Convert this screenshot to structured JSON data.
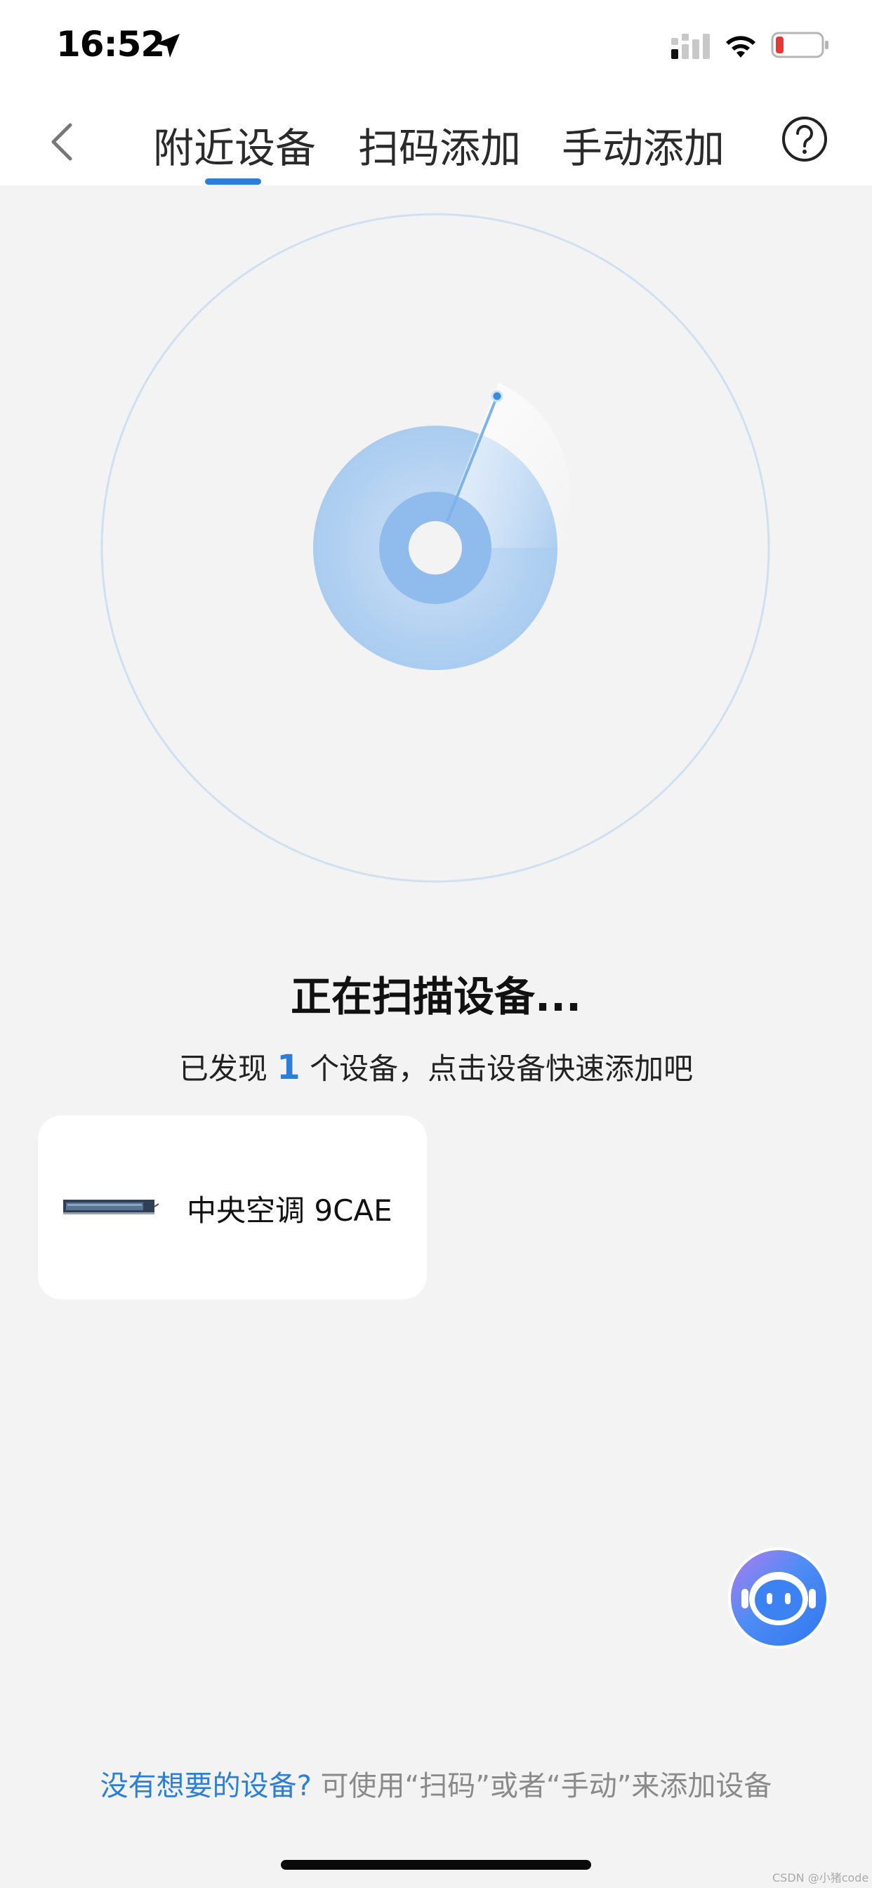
{
  "status_bar": {
    "time": "16:52",
    "battery_color": "#e53935"
  },
  "nav": {
    "tabs": [
      {
        "label": "附近设备",
        "active": true
      },
      {
        "label": "扫码添加",
        "active": false
      },
      {
        "label": "手动添加",
        "active": false
      }
    ],
    "accent_color": "#2b7fd9"
  },
  "scan": {
    "title": "正在扫描设备...",
    "found_prefix": "已发现",
    "found_count": "1",
    "found_suffix": "个设备，点击设备快速添加吧"
  },
  "devices": [
    {
      "name": "中央空调 9CAE",
      "icon": "central-ac-unit-icon"
    }
  ],
  "footer": {
    "link_text": "没有想要的设备?",
    "rest_text": "可使用“扫码”或者“手动”来添加设备"
  },
  "watermark": "CSDN @小猪code"
}
